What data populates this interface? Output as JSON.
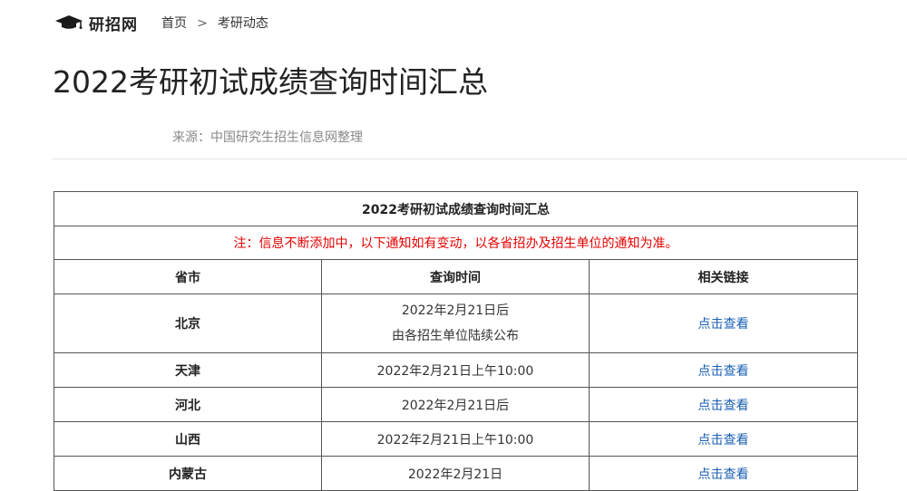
{
  "brand": {
    "name": "研招网",
    "icon": "graduation-cap-icon"
  },
  "breadcrumb": {
    "home": "首页",
    "separator": ">",
    "current": "考研动态"
  },
  "article": {
    "title": "2022考研初试成绩查询时间汇总",
    "source": "来源：中国研究生招生信息网整理"
  },
  "table": {
    "title": "2022考研初试成绩查询时间汇总",
    "note": "注：信息不断添加中，以下通知如有变动，以各省招办及招生单位的通知为准。",
    "columns": [
      "省市",
      "查询时间",
      "相关链接"
    ],
    "rows": [
      {
        "province": "北京",
        "time": [
          "2022年2月21日后",
          "由各招生单位陆续公布"
        ],
        "link": "点击查看"
      },
      {
        "province": "天津",
        "time": [
          "2022年2月21日上午10:00"
        ],
        "link": "点击查看"
      },
      {
        "province": "河北",
        "time": [
          "2022年2月21日后"
        ],
        "link": "点击查看"
      },
      {
        "province": "山西",
        "time": [
          "2022年2月21日上午10:00"
        ],
        "link": "点击查看"
      },
      {
        "province": "内蒙古",
        "time": [
          "2022年2月21日"
        ],
        "link": "点击查看"
      }
    ]
  },
  "colors": {
    "note": "#e60000",
    "link": "#1a5fb4",
    "border": "#555555",
    "muted": "#888888"
  }
}
